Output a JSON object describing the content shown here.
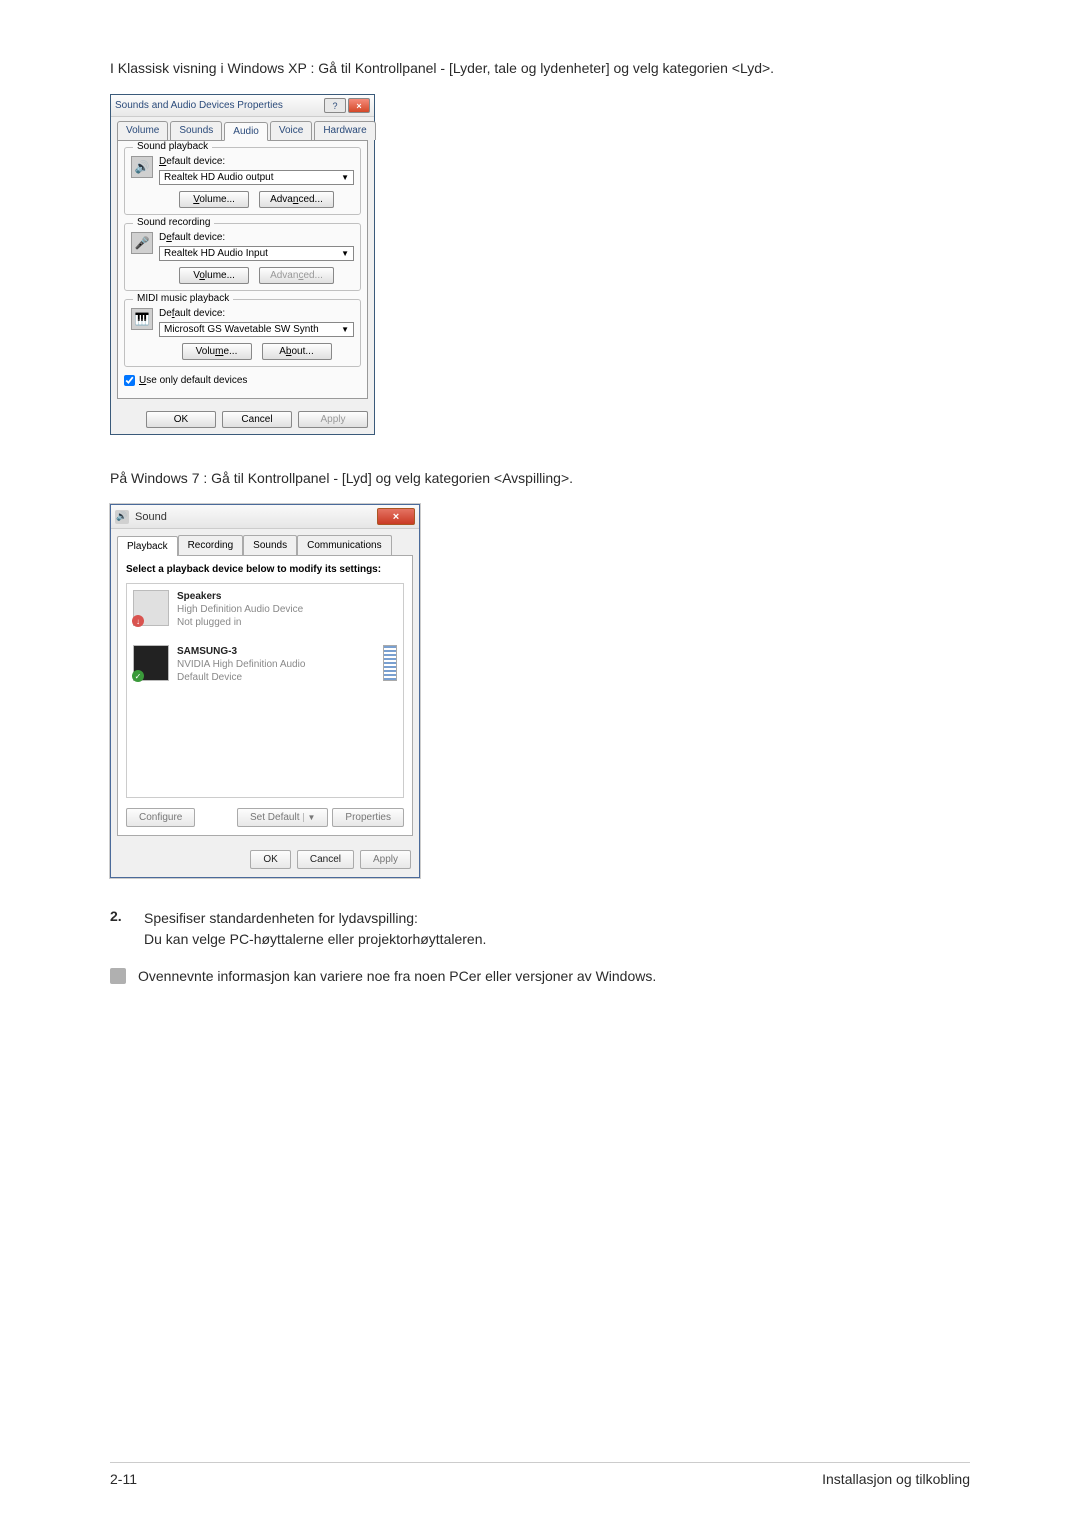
{
  "intro_xp": "I Klassisk visning i Windows XP : Gå til Kontrollpanel - [Lyder, tale og lydenheter] og velg kategorien <Lyd>.",
  "intro_7": "På Windows 7 : Gå til Kontrollpanel - [Lyd] og velg kategorien <Avspilling>.",
  "xp_dialog": {
    "title": "Sounds and Audio Devices Properties",
    "tabs": [
      "Volume",
      "Sounds",
      "Audio",
      "Voice",
      "Hardware"
    ],
    "active_tab_index": 2,
    "playback": {
      "legend": "Sound playback",
      "label": "Default device:",
      "value": "Realtek HD Audio output",
      "volume_btn": "Volume...",
      "adv_btn": "Advanced..."
    },
    "recording": {
      "legend": "Sound recording",
      "label": "Default device:",
      "value": "Realtek HD Audio Input",
      "volume_btn": "Volume...",
      "adv_btn": "Advanced..."
    },
    "midi": {
      "legend": "MIDI music playback",
      "label": "Default device:",
      "value": "Microsoft GS Wavetable SW Synth",
      "volume_btn": "Volume...",
      "about_btn": "About..."
    },
    "use_only_default": "Use only default devices",
    "ok": "OK",
    "cancel": "Cancel",
    "apply": "Apply"
  },
  "w7_dialog": {
    "title": "Sound",
    "tabs": [
      "Playback",
      "Recording",
      "Sounds",
      "Communications"
    ],
    "active_tab_index": 0,
    "prompt": "Select a playback device below to modify its settings:",
    "dev1": {
      "name": "Speakers",
      "line2": "High Definition Audio Device",
      "line3": "Not plugged in"
    },
    "dev2": {
      "name": "SAMSUNG-3",
      "line2": "NVIDIA High Definition Audio",
      "line3": "Default Device"
    },
    "configure": "Configure",
    "set_default": "Set Default",
    "properties": "Properties",
    "ok": "OK",
    "cancel": "Cancel",
    "apply": "Apply"
  },
  "step2": {
    "num": "2.",
    "line1": "Spesifiser standardenheten for lydavspilling:",
    "line2": "Du kan velge PC-høyttalerne eller projektorhøyttaleren."
  },
  "note_text": "Ovennevnte informasjon kan variere noe fra noen PCer eller versjoner av Windows.",
  "footer": {
    "left": "2-11",
    "right": "Installasjon og tilkobling"
  }
}
